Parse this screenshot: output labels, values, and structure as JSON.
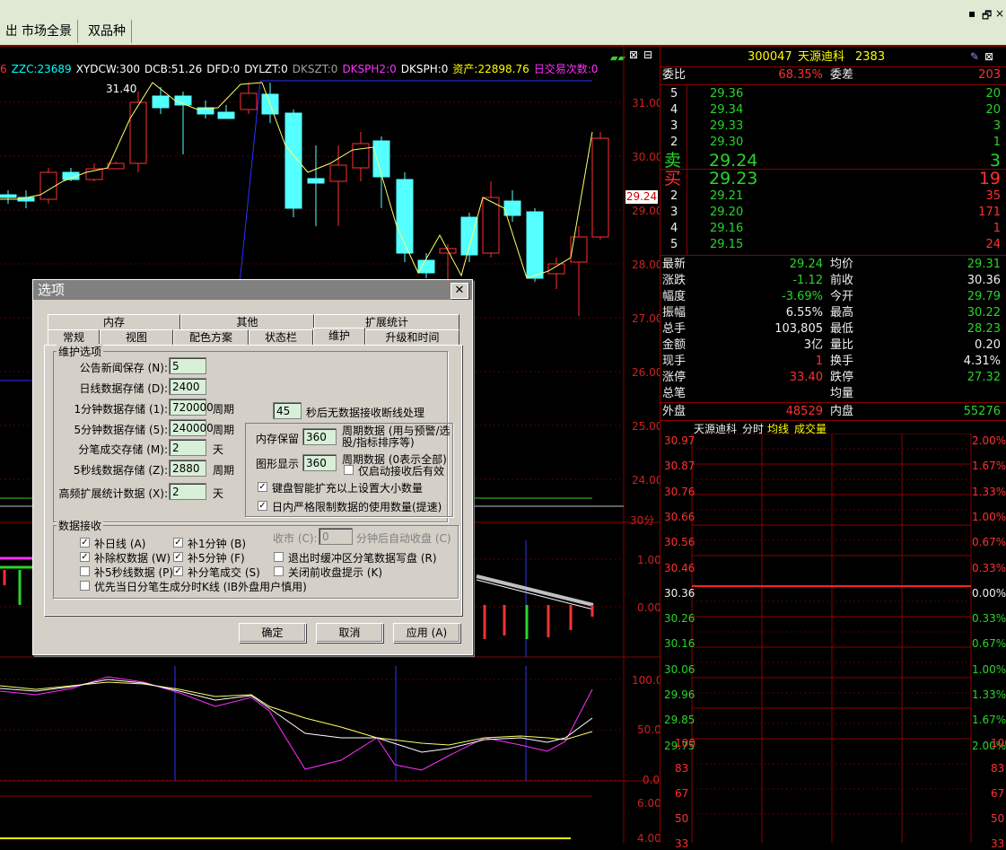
{
  "menu": {
    "items": [
      "出",
      "市场全景",
      "双品种"
    ],
    "minimize": "▪",
    "restore": "🗗",
    "close": "×"
  },
  "kline": {
    "indicators": [
      {
        "text": "6",
        "color": "#ff3030"
      },
      {
        "text": "ZZC:23689",
        "color": "#00ffff"
      },
      {
        "text": "XYDCW:300",
        "color": "#ffffff"
      },
      {
        "text": "DCB:51.26",
        "color": "#ffffff"
      },
      {
        "text": "DFD:0",
        "color": "#ffffff"
      },
      {
        "text": "DYLZT:0",
        "color": "#ffffff"
      },
      {
        "text": "DKSZT:0",
        "color": "#a0a0a0"
      },
      {
        "text": "DKSPH2:0",
        "color": "#ff30ff"
      },
      {
        "text": "DKSPH:0",
        "color": "#ffffff"
      },
      {
        "text": "资产:22898.76",
        "color": "#ffff00"
      },
      {
        "text": "日交易次数:0",
        "color": "#ff30ff"
      }
    ],
    "high_label": "31.40",
    "price_ticks": [
      "31.00",
      "30.00",
      "29.00",
      "28.00",
      "27.00",
      "26.00",
      "25.00",
      "24.00"
    ],
    "current_price_tag": "29.24",
    "period_label": "30分",
    "macd_ticks": [
      "1.00",
      "0.00"
    ],
    "kd_ticks": [
      "100.0",
      "50.0",
      "0.0"
    ],
    "vol_ticks": [
      "6.00",
      "4.00"
    ]
  },
  "quote": {
    "code": "300047",
    "name": "天源迪科",
    "num": "2383",
    "weibi_label": "委比",
    "weibi": "68.35%",
    "weicha_label": "委差",
    "weicha": "203",
    "sell": [
      {
        "level": "5",
        "price": "29.36",
        "vol": "20"
      },
      {
        "level": "4",
        "price": "29.34",
        "vol": "20"
      },
      {
        "level": "3",
        "price": "29.33",
        "vol": "3"
      },
      {
        "level": "2",
        "price": "29.30",
        "vol": "1"
      },
      {
        "level": "卖",
        "price": "29.24",
        "vol": "3"
      }
    ],
    "buy": [
      {
        "level": "买",
        "price": "29.23",
        "vol": "19"
      },
      {
        "level": "2",
        "price": "29.21",
        "vol": "35"
      },
      {
        "level": "3",
        "price": "29.20",
        "vol": "171"
      },
      {
        "level": "4",
        "price": "29.16",
        "vol": "1"
      },
      {
        "level": "5",
        "price": "29.15",
        "vol": "24"
      }
    ],
    "stats": [
      {
        "l1": "最新",
        "v1": "29.24",
        "c1": "#2ad42a",
        "l2": "均价",
        "v2": "29.31",
        "c2": "#2ad42a"
      },
      {
        "l1": "涨跌",
        "v1": "-1.12",
        "c1": "#2ad42a",
        "l2": "前收",
        "v2": "30.36",
        "c2": "#f0f0f0"
      },
      {
        "l1": "幅度",
        "v1": "-3.69%",
        "c1": "#2ad42a",
        "l2": "今开",
        "v2": "29.79",
        "c2": "#2ad42a"
      },
      {
        "l1": "振幅",
        "v1": "6.55%",
        "c1": "#f0f0f0",
        "l2": "最高",
        "v2": "30.22",
        "c2": "#2ad42a"
      },
      {
        "l1": "总手",
        "v1": "103,805",
        "c1": "#f0f0f0",
        "l2": "最低",
        "v2": "28.23",
        "c2": "#2ad42a"
      },
      {
        "l1": "金额",
        "v1": "3亿",
        "c1": "#f0f0f0",
        "l2": "量比",
        "v2": "0.20",
        "c2": "#f0f0f0"
      },
      {
        "l1": "现手",
        "v1": "1",
        "c1": "#ff3030",
        "l2": "换手",
        "v2": "4.31%",
        "c2": "#f0f0f0"
      },
      {
        "l1": "涨停",
        "v1": "33.40",
        "c1": "#ff3030",
        "l2": "跌停",
        "v2": "27.32",
        "c2": "#2ad42a"
      },
      {
        "l1": "总笔",
        "v1": "",
        "c1": "#f0f0f0",
        "l2": "均量",
        "v2": "",
        "c2": "#f0f0f0"
      }
    ],
    "waipan_label": "外盘",
    "waipan": "48529",
    "neipan_label": "内盘",
    "neipan": "55276"
  },
  "intraday": {
    "title_name": "天源迪科",
    "title_fenshi": "分时",
    "title_avg": "均线",
    "title_vol": "成交量",
    "left_ticks": [
      "30.97",
      "30.87",
      "30.76",
      "30.66",
      "30.56",
      "30.46",
      "30.36",
      "30.26",
      "30.16",
      "30.06",
      "29.96",
      "29.85",
      "29.75"
    ],
    "right_ticks": [
      "2.00%",
      "1.67%",
      "1.33%",
      "1.00%",
      "0.67%",
      "0.33%",
      "0.00%",
      "0.33%",
      "0.67%",
      "1.00%",
      "1.33%",
      "1.67%",
      "2.00%"
    ],
    "vol_ticks": [
      "100",
      "83",
      "67",
      "50",
      "33"
    ]
  },
  "dialog": {
    "title": "选项",
    "close": "✕",
    "tabs_row1": [
      "内存",
      "其他",
      "扩展统计"
    ],
    "tabs_row2": [
      "常规",
      "视图",
      "配色方案",
      "状态栏",
      "维护",
      "升级和时间"
    ],
    "group1_title": "维护选项",
    "fields": [
      {
        "label": "公告新闻保存 (N):",
        "value": "5",
        "unit": ""
      },
      {
        "label": "日线数据存储 (D):",
        "value": "2400",
        "unit": ""
      },
      {
        "label": "1分钟数据存储 (1):",
        "value": "720000",
        "unit": "周期"
      },
      {
        "label": "5分钟数据存储 (5):",
        "value": "240000",
        "unit": "周期"
      },
      {
        "label": "分笔成交存储 (M):",
        "value": "2",
        "unit": "天"
      },
      {
        "label": "5秒线数据存储 (Z):",
        "value": "2880",
        "unit": "周期"
      },
      {
        "label": "高频扩展统计数据 (X):",
        "value": "2",
        "unit": "天"
      }
    ],
    "timeout_value": "45",
    "timeout_label": "秒后无数据接收断线处理",
    "mem_label": "内存保留",
    "mem_value": "360",
    "mem_desc": "周期数据 (用与预警/选股/指标排序等)",
    "draw_label": "图形显示",
    "draw_value": "360",
    "draw_desc": "周期数据 (0表示全部)",
    "draw_check": "仅启动接收后有效",
    "check_keyboard": "键盘智能扩充以上设置大小数量",
    "check_intraday": "日内严格限制数据的使用数量(提速)",
    "group2_title": "数据接收",
    "recv_checks": [
      {
        "label": "补日线 (A)",
        "checked": "✓"
      },
      {
        "label": "补1分钟 (B)",
        "checked": "✓"
      },
      {
        "label": "补除权数据 (W)",
        "checked": "✓"
      },
      {
        "label": "补5分钟 (F)",
        "checked": "✓"
      },
      {
        "label": "补5秒线数据 (P)",
        "checked": ""
      },
      {
        "label": "补分笔成交 (S)",
        "checked": "✓"
      },
      {
        "label": "优先当日分笔生成分时K线 (IB外盘用户慎用)",
        "checked": ""
      }
    ],
    "close_market_label": "收市 (C):",
    "close_market_value": "0",
    "close_market_desc": "分钟后自动收盘 (C)",
    "check_exit_write": "退出时缓冲区分笔数据写盘 (R)",
    "check_close_tip": "关闭前收盘提示 (K)",
    "btn_ok": "确定",
    "btn_cancel": "取消",
    "btn_apply": "应用 (A)"
  }
}
